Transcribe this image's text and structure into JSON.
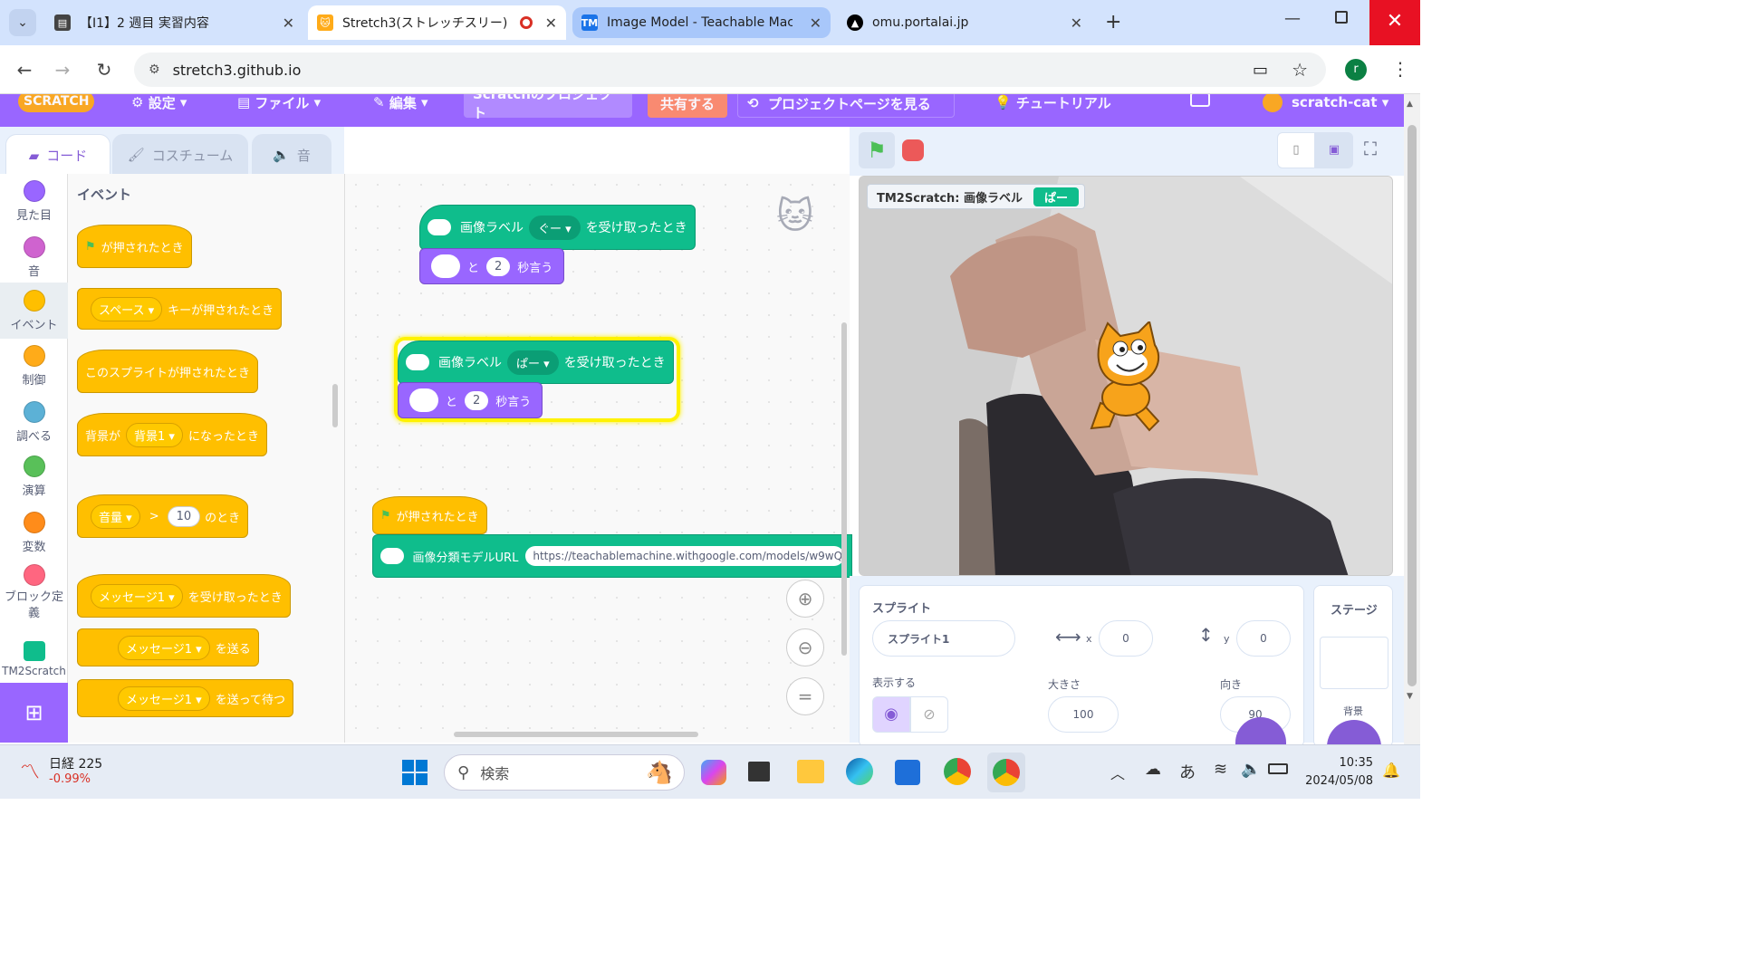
{
  "browser": {
    "tabs": [
      {
        "title": "【I1】2 週目 実習内容",
        "icon": "doc-icon"
      },
      {
        "title": "Stretch3(ストレッチスリー)",
        "icon": "scratch-cat-icon"
      },
      {
        "title": "Image Model - Teachable Mach",
        "icon": "tm-icon"
      },
      {
        "title": "omu.portalai.jp",
        "icon": "triangle-logo-icon"
      }
    ],
    "url": "stretch3.github.io",
    "profile_initial": "r"
  },
  "menu": {
    "logo": "SCRATCH",
    "settings": "設定",
    "file": "ファイル",
    "edit": "編集",
    "project_title": "Scratchのプロジェクト",
    "share": "共有する",
    "see_project": "プロジェクトページを見る",
    "tutorial": "チュートリアル",
    "user": "scratch-cat"
  },
  "editor_tabs": {
    "code": "コード",
    "costume": "コスチューム",
    "sound": "音"
  },
  "categories": [
    {
      "label": "見た目",
      "color": "#9966ff"
    },
    {
      "label": "音",
      "color": "#cf63cf"
    },
    {
      "label": "イベント",
      "color": "#ffbf00"
    },
    {
      "label": "制御",
      "color": "#ffab19"
    },
    {
      "label": "調べる",
      "color": "#5cb1d6"
    },
    {
      "label": "演算",
      "color": "#59c059"
    },
    {
      "label": "変数",
      "color": "#ff8c1a"
    },
    {
      "label": "ブロック定義",
      "color": "#ff6680"
    },
    {
      "label": "TM2Scratch",
      "color": "#0fbd8c"
    }
  ],
  "palette": {
    "heading": "イベント",
    "flag_clicked": "が押されたとき",
    "key_dropdown": "スペース",
    "key_pressed": "キーが押されたとき",
    "sprite_clicked": "このスプライトが押されたとき",
    "backdrop_prefix": "背景が",
    "backdrop_dropdown": "背景1",
    "backdrop_suffix": "になったとき",
    "loudness_dropdown": "音量",
    "gt": ">",
    "loudness_value": "10",
    "loudness_suffix": "のとき",
    "message_dropdown": "メッセージ1",
    "receive_suffix": "を受け取ったとき",
    "broadcast_suffix": "を送る",
    "broadcast_wait_suffix": "を送って待つ"
  },
  "script": {
    "label_prefix": "画像ラベル",
    "label1": "ぐー",
    "label2": "ぱー",
    "received": "を受け取ったとき",
    "and": "と",
    "secs": "2",
    "say_secs": "秒言う",
    "flag_clicked": "が押されたとき",
    "model_url_label": "画像分類モデルURL",
    "model_url": "https://teachablemachine.withgoogle.com/models/w9wQ"
  },
  "stage": {
    "monitor_label": "TM2Scratch: 画像ラベル",
    "monitor_value": "ぱー"
  },
  "sprite_info": {
    "sprite_heading": "スプライト",
    "sprite_name": "スプライト1",
    "x_label": "x",
    "x": "0",
    "y_label": "y",
    "y": "0",
    "show_label": "表示する",
    "size_label": "大きさ",
    "size": "100",
    "direction_label": "向き",
    "direction": "90",
    "stage_heading": "ステージ",
    "backdrop_label": "背景"
  },
  "taskbar": {
    "stock_name": "日経 225",
    "stock_change": "-0.99%",
    "search": "検索",
    "ime": "あ",
    "time": "10:35",
    "date": "2024/05/08"
  },
  "colors": {
    "scratch_purple": "#9966ff",
    "events_yellow": "#ffbf00",
    "extension_green": "#0fbd8c",
    "close_red": "#e81123"
  }
}
